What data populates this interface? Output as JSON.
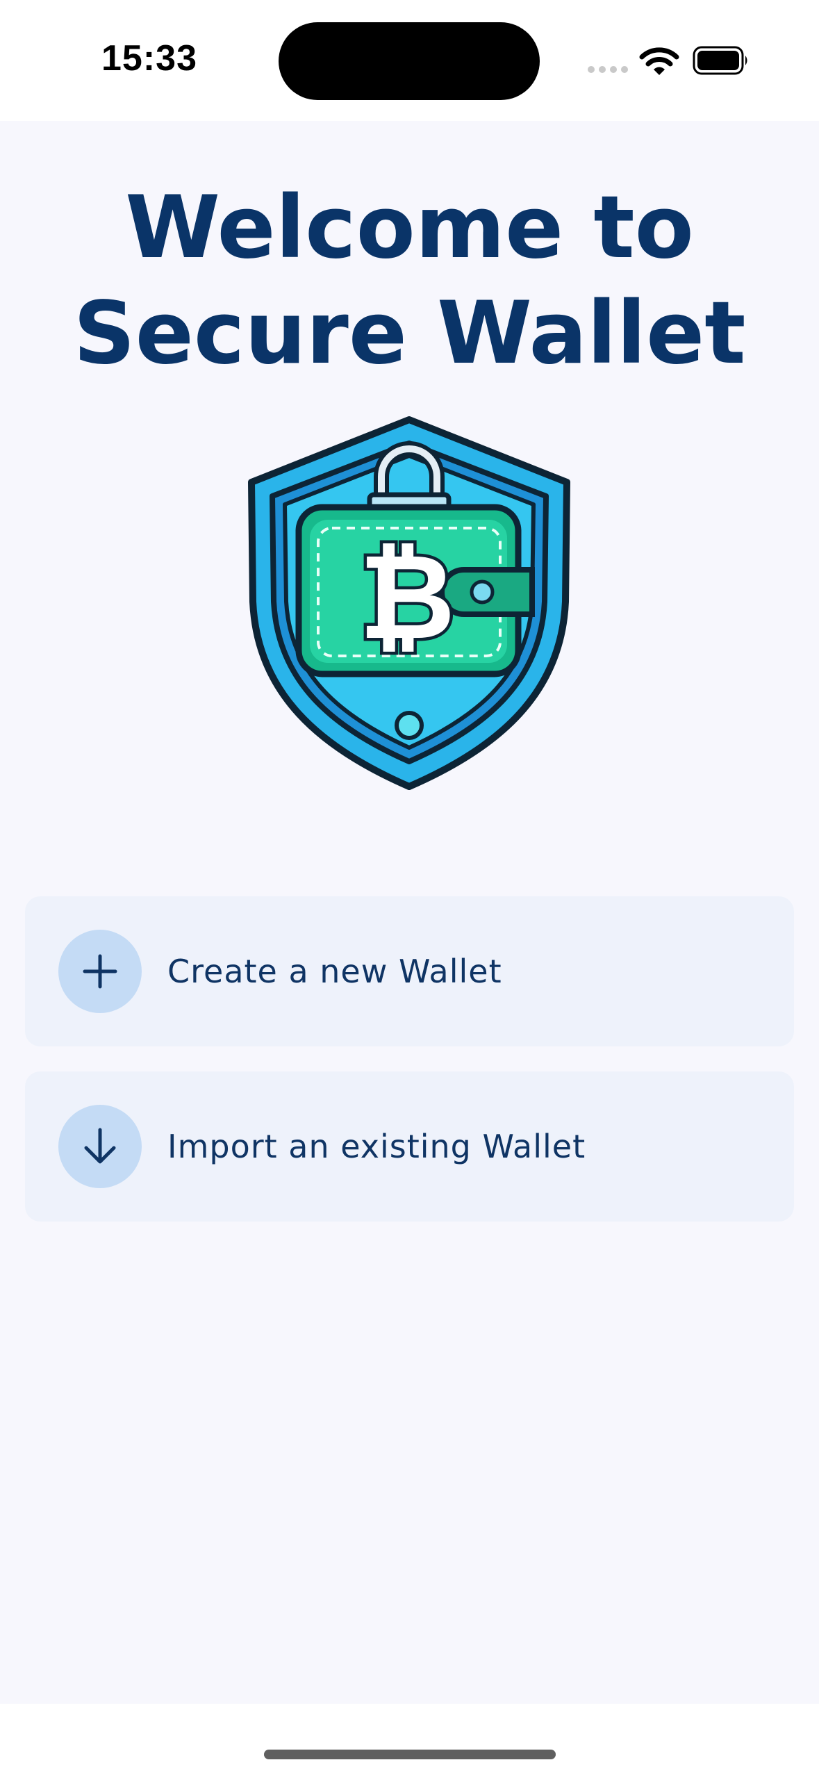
{
  "status_bar": {
    "time": "15:33",
    "icons": [
      "cellular-signal-icon",
      "wifi-icon",
      "battery-icon"
    ]
  },
  "main": {
    "title": "Welcome to Secure Wallet",
    "logo_icon": "shield-wallet-bitcoin-icon",
    "actions": [
      {
        "label": "Create a new Wallet",
        "icon": "plus-icon"
      },
      {
        "label": "Import an existing Wallet",
        "icon": "arrow-down-icon"
      }
    ]
  },
  "colors": {
    "title": "#0a3468",
    "background": "#f7f7fd",
    "card_background": "#eef2fb",
    "icon_circle": "#c4dbf5",
    "label": "#0f3464"
  }
}
